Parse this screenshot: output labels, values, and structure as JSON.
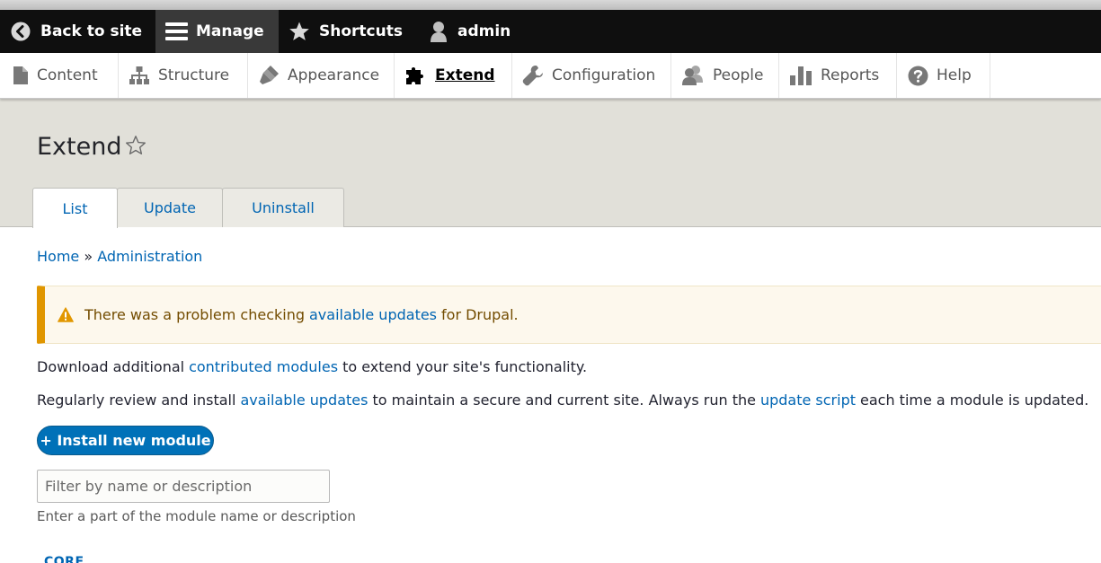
{
  "admin_bar": {
    "back_label": "Back to site",
    "manage_label": "Manage",
    "shortcuts_label": "Shortcuts",
    "user_label": "admin"
  },
  "tray": {
    "items": [
      {
        "label": "Content",
        "icon": "file-icon"
      },
      {
        "label": "Structure",
        "icon": "sitemap-icon"
      },
      {
        "label": "Appearance",
        "icon": "paintbrush-icon"
      },
      {
        "label": "Extend",
        "icon": "puzzle-icon",
        "active": true
      },
      {
        "label": "Configuration",
        "icon": "wrench-icon"
      },
      {
        "label": "People",
        "icon": "people-icon"
      },
      {
        "label": "Reports",
        "icon": "bar-chart-icon"
      },
      {
        "label": "Help",
        "icon": "help-icon"
      }
    ]
  },
  "page": {
    "title": "Extend",
    "tabs": [
      {
        "label": "List",
        "active": true
      },
      {
        "label": "Update"
      },
      {
        "label": "Uninstall"
      }
    ]
  },
  "breadcrumb": {
    "home": "Home",
    "separator": "»",
    "admin": "Administration"
  },
  "warning": {
    "text_before": "There was a problem checking",
    "link": "available updates",
    "text_after": "for Drupal."
  },
  "intro": {
    "p1_before": "Download additional",
    "p1_link": "contributed modules",
    "p1_after": "to extend your site's functionality.",
    "p2_before": "Regularly review and install",
    "p2_link1": "available updates",
    "p2_middle": "to maintain a secure and current site. Always run the",
    "p2_link2": "update script",
    "p2_after": "each time a module is updated."
  },
  "install_button": "+ Install new module",
  "filter": {
    "placeholder": "Filter by name or description",
    "value": "",
    "help": "Enter a part of the module name or description"
  },
  "section_heading": "CORE",
  "colors": {
    "admin_bar_bg": "#0f0f0f",
    "link": "#0065b3",
    "warning_border": "#e09600",
    "button": "#0071b8"
  }
}
